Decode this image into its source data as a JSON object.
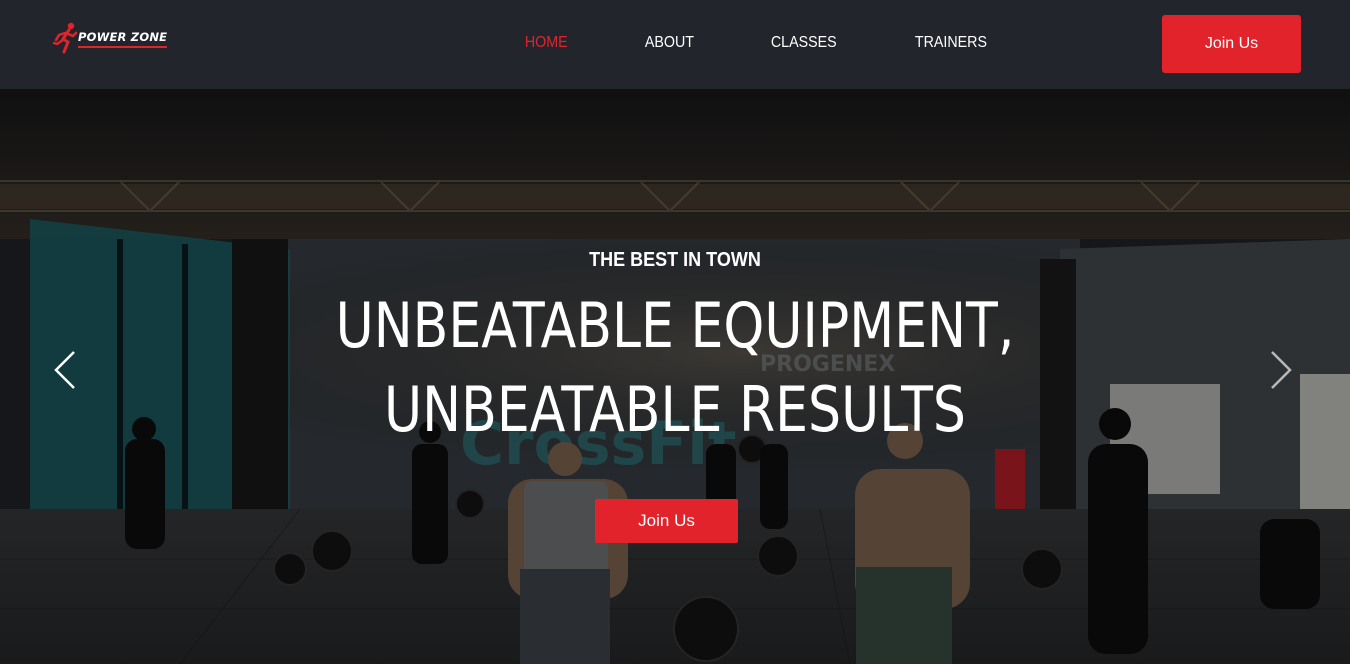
{
  "brand": {
    "name": "POWER ZONE",
    "accent": "#e2232b",
    "logo_icon": "runner-icon"
  },
  "nav": {
    "links": [
      {
        "label": "HOME",
        "active": true
      },
      {
        "label": "ABOUT",
        "active": false
      },
      {
        "label": "CLASSES",
        "active": false
      },
      {
        "label": "TRAINERS",
        "active": false
      }
    ],
    "cta_label": "Join Us"
  },
  "hero": {
    "eyebrow": "THE BEST IN TOWN",
    "title_line1": "UNBEATABLE EQUIPMENT,",
    "title_line2": "UNBEATABLE RESULTS",
    "cta_label": "Join Us",
    "prev_icon": "chevron-left-icon",
    "next_icon": "chevron-right-icon"
  },
  "colors": {
    "navbar_bg": "#22262c",
    "text": "#ffffff"
  }
}
